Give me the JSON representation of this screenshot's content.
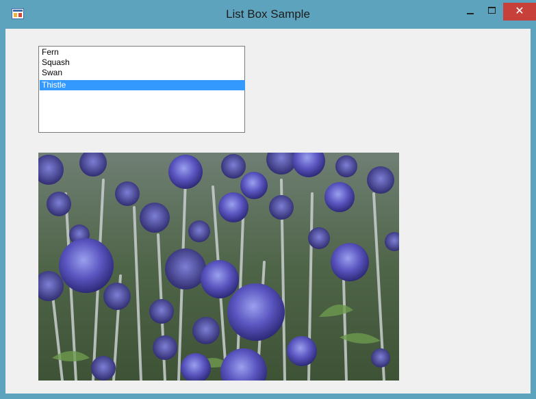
{
  "window": {
    "title": "List Box Sample",
    "close_glyph": "✕"
  },
  "listbox": {
    "items": [
      {
        "label": "Fern",
        "selected": false
      },
      {
        "label": "Squash",
        "selected": false
      },
      {
        "label": "Swan",
        "selected": false
      },
      {
        "label": "Thistle",
        "selected": true
      }
    ],
    "selection_color": "#3399ff"
  },
  "picture": {
    "subject": "globe thistle flowers",
    "flower_color": "#5a55c0",
    "foliage_color": "#5c7a52"
  },
  "colors": {
    "titlebar": "#5ea3bd",
    "close_button": "#c7413a",
    "client_background": "#f0f0f0"
  },
  "icons": [
    "app-icon",
    "minimize-icon",
    "maximize-icon",
    "close-icon"
  ]
}
